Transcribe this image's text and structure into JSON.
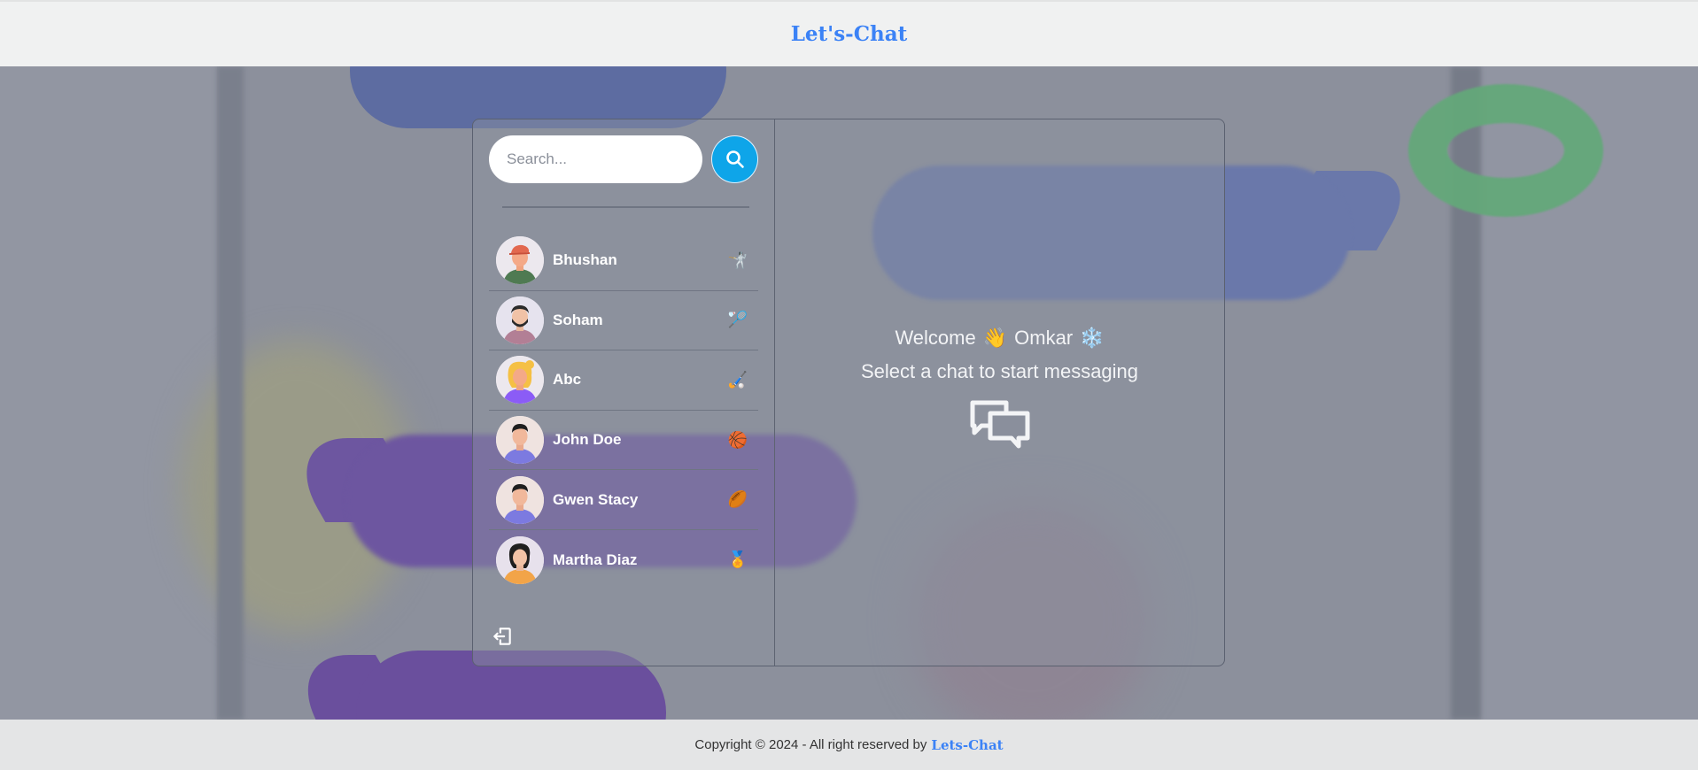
{
  "header": {
    "title": "Let's-Chat"
  },
  "sidebar": {
    "search": {
      "placeholder": "Search...",
      "value": ""
    },
    "search_button_icon": "search-icon",
    "contacts": [
      {
        "name": "Bhushan",
        "emoji": "🤺",
        "avatar": "avatar-man-cap"
      },
      {
        "name": "Soham",
        "emoji": "🏸",
        "avatar": "avatar-man-beard"
      },
      {
        "name": "Abc",
        "emoji": "🏑",
        "avatar": "avatar-woman-blonde"
      },
      {
        "name": "John Doe",
        "emoji": "🏀",
        "avatar": "avatar-man"
      },
      {
        "name": "Gwen Stacy",
        "emoji": "🏉",
        "avatar": "avatar-man"
      },
      {
        "name": "Martha Diaz",
        "emoji": "🏅",
        "avatar": "avatar-woman"
      }
    ],
    "logout_icon": "logout-icon"
  },
  "main": {
    "welcome_label": "Welcome",
    "wave_emoji": "👋",
    "user_name": "Omkar",
    "snow_emoji": "❄️",
    "subtitle": "Select a chat to start messaging",
    "chat_icon": "chat-bubbles-icon"
  },
  "footer": {
    "copyright": "Copyright © 2024 - All right reserved by",
    "brand": "Lets-Chat"
  },
  "colors": {
    "accent": "#3b82f6",
    "search_button": "#0ea5e9",
    "header_bg": "#f0f1f1",
    "footer_bg": "#e4e5e6"
  }
}
